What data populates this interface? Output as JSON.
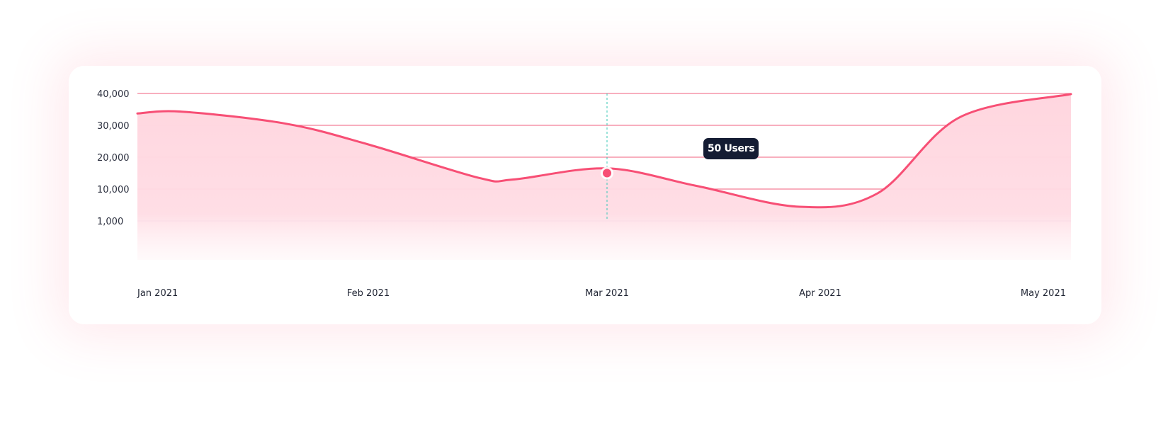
{
  "colors": {
    "line": "#f74f75",
    "area": "#ffd6df",
    "grid": "#f47f98",
    "baseline": "#e3dbf2",
    "crosshair": "#39c7b6",
    "tooltip_bg": "#141c33",
    "text": "#1f2433"
  },
  "chart_data": {
    "type": "area",
    "title": "",
    "xlabel": "",
    "ylabel": "",
    "x_ticks": [
      "Jan 2021",
      "Feb 2021",
      "Mar 2021",
      "Apr 2021",
      "May 2021"
    ],
    "y_ticks": [
      "40,000",
      "30,000",
      "20,000",
      "10,000",
      "1,000"
    ],
    "y_tick_values": [
      40000,
      30000,
      20000,
      10000,
      1000
    ],
    "ylim": [
      1000,
      40000
    ],
    "grid": true,
    "series": [
      {
        "x": [
          "2021-01-01",
          "2021-01-07",
          "2021-01-21",
          "2021-02-01",
          "2021-02-14",
          "2021-02-18",
          "2021-03-01",
          "2021-03-14",
          "2021-03-29",
          "2021-04-08",
          "2021-04-18",
          "2021-05-01"
        ],
        "values": [
          33700,
          34300,
          30500,
          24000,
          13500,
          13000,
          16500,
          11000,
          5000,
          8800,
          32500,
          39800
        ]
      }
    ],
    "highlight": {
      "x": "2021-03-01",
      "value": 15000,
      "tooltip": "50 Users"
    }
  }
}
